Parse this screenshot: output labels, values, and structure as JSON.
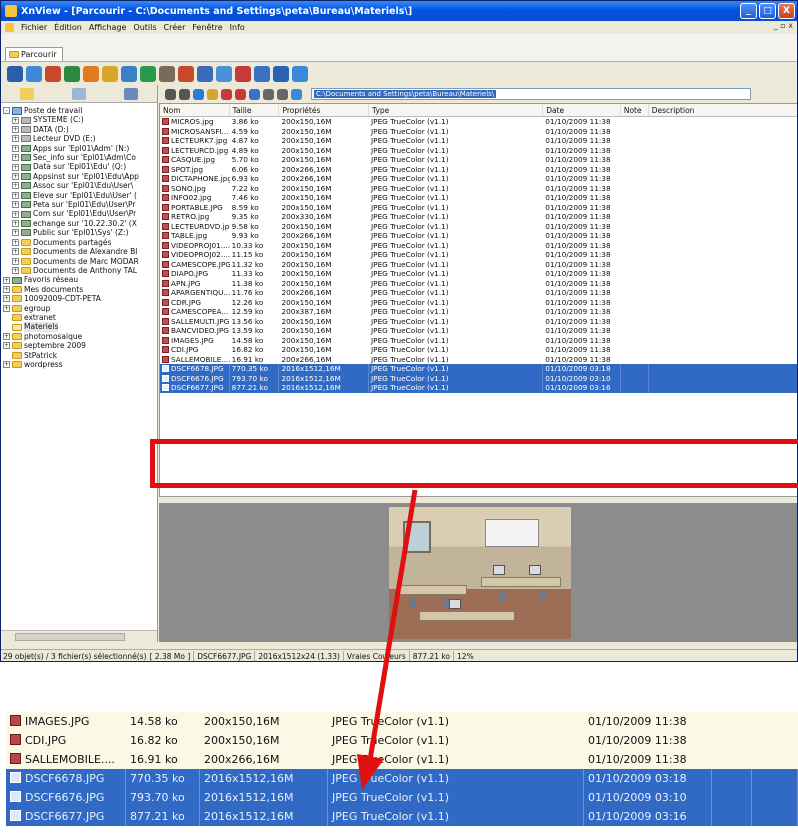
{
  "window": {
    "title": "XnView - [Parcourir - C:\\Documents and Settings\\peta\\Bureau\\Materiels\\]",
    "controls": [
      "_",
      "□",
      "X"
    ]
  },
  "menu": {
    "items": [
      "Fichier",
      "Édition",
      "Affichage",
      "Outils",
      "Créer",
      "Fenêtre",
      "Info"
    ],
    "mdi_controls": "_ ▫ x"
  },
  "tab": {
    "label": "Parcourir"
  },
  "address": {
    "path": "C:\\Documents and Settings\\peta\\Bureau\\Materiels\\"
  },
  "tree": [
    {
      "label": "Poste de travail",
      "icon": "pc",
      "indent": 0,
      "pm": "-"
    },
    {
      "label": "SYSTEME (C:)",
      "icon": "drive",
      "indent": 1,
      "pm": "+"
    },
    {
      "label": "DATA (D:)",
      "icon": "drive",
      "indent": 1,
      "pm": "+"
    },
    {
      "label": "Lecteur DVD (E:)",
      "icon": "drive",
      "indent": 1,
      "pm": "+"
    },
    {
      "label": "Apps sur 'Epl01\\Adm' (N:)",
      "icon": "net",
      "indent": 1,
      "pm": "+"
    },
    {
      "label": "Sec_info sur 'Epl01\\Adm\\Co",
      "icon": "net",
      "indent": 1,
      "pm": "+"
    },
    {
      "label": "Data sur 'Epl01\\Edu' (Q:)",
      "icon": "net",
      "indent": 1,
      "pm": "+"
    },
    {
      "label": "Appsinst sur 'Epl01\\Edu\\App",
      "icon": "net",
      "indent": 1,
      "pm": "+"
    },
    {
      "label": "Assoc sur 'Epl01\\Edu\\User\\",
      "icon": "net",
      "indent": 1,
      "pm": "+"
    },
    {
      "label": "Eleve sur 'Epl01\\Edu\\User' (",
      "icon": "net",
      "indent": 1,
      "pm": "+"
    },
    {
      "label": "Peta sur 'Epl01\\Edu\\User\\Pr",
      "icon": "net",
      "indent": 1,
      "pm": "+"
    },
    {
      "label": "Com sur 'Epl01\\Edu\\User\\Pr",
      "icon": "net",
      "indent": 1,
      "pm": "+"
    },
    {
      "label": "echange sur '10.22.30.2' (X",
      "icon": "net",
      "indent": 1,
      "pm": "+"
    },
    {
      "label": "Public sur 'Epl01\\Sys' (Z:)",
      "icon": "net",
      "indent": 1,
      "pm": "+"
    },
    {
      "label": "Documents partagés",
      "icon": "folder",
      "indent": 1,
      "pm": "+"
    },
    {
      "label": "Documents de Alexandre Bl",
      "icon": "folder",
      "indent": 1,
      "pm": "+"
    },
    {
      "label": "Documents de Marc MODAR",
      "icon": "folder",
      "indent": 1,
      "pm": "+"
    },
    {
      "label": "Documents de Anthony TAL",
      "icon": "folder",
      "indent": 1,
      "pm": "+"
    },
    {
      "label": "Favoris réseau",
      "icon": "net",
      "indent": 0,
      "pm": "+"
    },
    {
      "label": "Mes documents",
      "icon": "folder",
      "indent": 0,
      "pm": "+"
    },
    {
      "label": "10092009-CDT-PETA",
      "icon": "folder",
      "indent": 0,
      "pm": "+"
    },
    {
      "label": "egroup",
      "icon": "folder",
      "indent": 0,
      "pm": "+"
    },
    {
      "label": "extranet",
      "icon": "folder",
      "indent": 0,
      "pm": ""
    },
    {
      "label": "Materiels",
      "icon": "folder-open",
      "indent": 0,
      "pm": ""
    },
    {
      "label": "photomosaique",
      "icon": "folder",
      "indent": 0,
      "pm": "+"
    },
    {
      "label": "septembre 2009",
      "icon": "folder",
      "indent": 0,
      "pm": "+"
    },
    {
      "label": "StPatrick",
      "icon": "folder",
      "indent": 0,
      "pm": ""
    },
    {
      "label": "wordpress",
      "icon": "folder",
      "indent": 0,
      "pm": "+"
    }
  ],
  "list": {
    "columns": [
      "Nom",
      "Taille",
      "Propriétés",
      "Type",
      "Date",
      "Note",
      "Description"
    ],
    "rows": [
      {
        "name": "MICROS.jpg",
        "size": "3.86 ko",
        "props": "200x150,16M",
        "type": "JPEG TrueColor (v1.1)",
        "date": "01/10/2009 11:38",
        "selected": false
      },
      {
        "name": "MICROSANSFI...",
        "size": "4.59 ko",
        "props": "200x150,16M",
        "type": "JPEG TrueColor (v1.1)",
        "date": "01/10/2009 11:38",
        "selected": false
      },
      {
        "name": "LECTEURK7.jpg",
        "size": "4.87 ko",
        "props": "200x150,16M",
        "type": "JPEG TrueColor (v1.1)",
        "date": "01/10/2009 11:38",
        "selected": false
      },
      {
        "name": "LECTEURCD.jpg",
        "size": "4.89 ko",
        "props": "200x150,16M",
        "type": "JPEG TrueColor (v1.1)",
        "date": "01/10/2009 11:38",
        "selected": false
      },
      {
        "name": "CASQUE.jpg",
        "size": "5.70 ko",
        "props": "200x150,16M",
        "type": "JPEG TrueColor (v1.1)",
        "date": "01/10/2009 11:38",
        "selected": false
      },
      {
        "name": "SPOT.jpg",
        "size": "6.06 ko",
        "props": "200x266,16M",
        "type": "JPEG TrueColor (v1.1)",
        "date": "01/10/2009 11:38",
        "selected": false
      },
      {
        "name": "DICTAPHONE.jpg",
        "size": "6.93 ko",
        "props": "200x266,16M",
        "type": "JPEG TrueColor (v1.1)",
        "date": "01/10/2009 11:38",
        "selected": false
      },
      {
        "name": "SONO.jpg",
        "size": "7.22 ko",
        "props": "200x150,16M",
        "type": "JPEG TrueColor (v1.1)",
        "date": "01/10/2009 11:38",
        "selected": false
      },
      {
        "name": "INFO02.jpg",
        "size": "7.46 ko",
        "props": "200x150,16M",
        "type": "JPEG TrueColor (v1.1)",
        "date": "01/10/2009 11:38",
        "selected": false
      },
      {
        "name": "PORTABLE.JPG",
        "size": "8.59 ko",
        "props": "200x150,16M",
        "type": "JPEG TrueColor (v1.1)",
        "date": "01/10/2009 11:38",
        "selected": false
      },
      {
        "name": "RETRO.jpg",
        "size": "9.35 ko",
        "props": "200x330,16M",
        "type": "JPEG TrueColor (v1.1)",
        "date": "01/10/2009 11:38",
        "selected": false
      },
      {
        "name": "LECTEURDVD.jpg",
        "size": "9.58 ko",
        "props": "200x150,16M",
        "type": "JPEG TrueColor (v1.1)",
        "date": "01/10/2009 11:38",
        "selected": false
      },
      {
        "name": "TABLE.jpg",
        "size": "9.93 ko",
        "props": "200x266,16M",
        "type": "JPEG TrueColor (v1.1)",
        "date": "01/10/2009 11:38",
        "selected": false
      },
      {
        "name": "VIDEOPROJ01....",
        "size": "10.33 ko",
        "props": "200x150,16M",
        "type": "JPEG TrueColor (v1.1)",
        "date": "01/10/2009 11:38",
        "selected": false
      },
      {
        "name": "VIDEOPROJ02....",
        "size": "11.15 ko",
        "props": "200x150,16M",
        "type": "JPEG TrueColor (v1.1)",
        "date": "01/10/2009 11:38",
        "selected": false
      },
      {
        "name": "CAMESCOPE.JPG",
        "size": "11.32 ko",
        "props": "200x150,16M",
        "type": "JPEG TrueColor (v1.1)",
        "date": "01/10/2009 11:38",
        "selected": false
      },
      {
        "name": "DIAPO.JPG",
        "size": "11.33 ko",
        "props": "200x150,16M",
        "type": "JPEG TrueColor (v1.1)",
        "date": "01/10/2009 11:38",
        "selected": false
      },
      {
        "name": "APN.JPG",
        "size": "11.38 ko",
        "props": "200x150,16M",
        "type": "JPEG TrueColor (v1.1)",
        "date": "01/10/2009 11:38",
        "selected": false
      },
      {
        "name": "APARGENTIQU...",
        "size": "11.76 ko",
        "props": "200x266,16M",
        "type": "JPEG TrueColor (v1.1)",
        "date": "01/10/2009 11:38",
        "selected": false
      },
      {
        "name": "CDR.JPG",
        "size": "12.26 ko",
        "props": "200x150,16M",
        "type": "JPEG TrueColor (v1.1)",
        "date": "01/10/2009 11:38",
        "selected": false
      },
      {
        "name": "CAMESCOPEA...",
        "size": "12.59 ko",
        "props": "200x387,16M",
        "type": "JPEG TrueColor (v1.1)",
        "date": "01/10/2009 11:38",
        "selected": false
      },
      {
        "name": "SALLEMULTI.JPG",
        "size": "13.56 ko",
        "props": "200x150,16M",
        "type": "JPEG TrueColor (v1.1)",
        "date": "01/10/2009 11:38",
        "selected": false
      },
      {
        "name": "BANCVIDEO.JPG",
        "size": "13.59 ko",
        "props": "200x150,16M",
        "type": "JPEG TrueColor (v1.1)",
        "date": "01/10/2009 11:38",
        "selected": false
      },
      {
        "name": "IMAGES.JPG",
        "size": "14.58 ko",
        "props": "200x150,16M",
        "type": "JPEG TrueColor (v1.1)",
        "date": "01/10/2009 11:38",
        "selected": false
      },
      {
        "name": "CDI.JPG",
        "size": "16.82 ko",
        "props": "200x150,16M",
        "type": "JPEG TrueColor (v1.1)",
        "date": "01/10/2009 11:38",
        "selected": false
      },
      {
        "name": "SALLEMOBILE....",
        "size": "16.91 ko",
        "props": "200x266,16M",
        "type": "JPEG TrueColor (v1.1)",
        "date": "01/10/2009 11:38",
        "selected": false
      },
      {
        "name": "DSCF6678.JPG",
        "size": "770.35 ko",
        "props": "2016x1512,16M",
        "type": "JPEG TrueColor (v1.1)",
        "date": "01/10/2009 03:18",
        "selected": true
      },
      {
        "name": "DSCF6676.JPG",
        "size": "793.70 ko",
        "props": "2016x1512,16M",
        "type": "JPEG TrueColor (v1.1)",
        "date": "01/10/2009 03:10",
        "selected": true
      },
      {
        "name": "DSCF6677.JPG",
        "size": "877.21 ko",
        "props": "2016x1512,16M",
        "type": "JPEG TrueColor (v1.1)",
        "date": "01/10/2009 03:16",
        "selected": true
      }
    ]
  },
  "status": {
    "count": "29 objet(s) / 3 fichier(s) sélectionné(s)",
    "size": "[ 2.38 Mo ]",
    "file": "DSCF6677.JPG",
    "dims": "2016x1512x24 (1.33)",
    "colors": "Vraies Couleurs",
    "filesize": "877.21 ko",
    "zoom": "12%"
  },
  "zoom_rows": [
    {
      "name": "IMAGES.JPG",
      "size": "14.58 ko",
      "props": "200x150,16M",
      "type": "JPEG TrueColor (v1.1)",
      "date": "01/10/2009 11:38",
      "selected": false
    },
    {
      "name": "CDI.JPG",
      "size": "16.82 ko",
      "props": "200x150,16M",
      "type": "JPEG TrueColor (v1.1)",
      "date": "01/10/2009 11:38",
      "selected": false
    },
    {
      "name": "SALLEMOBILE....",
      "size": "16.91 ko",
      "props": "200x266,16M",
      "type": "JPEG TrueColor (v1.1)",
      "date": "01/10/2009 11:38",
      "selected": false
    },
    {
      "name": "DSCF6678.JPG",
      "size": "770.35 ko",
      "props": "2016x1512,16M",
      "type": "JPEG TrueColor (v1.1)",
      "date": "01/10/2009 03:18",
      "selected": true
    },
    {
      "name": "DSCF6676.JPG",
      "size": "793.70 ko",
      "props": "2016x1512,16M",
      "type": "JPEG TrueColor (v1.1)",
      "date": "01/10/2009 03:10",
      "selected": true
    },
    {
      "name": "DSCF6677.JPG",
      "size": "877.21 ko",
      "props": "2016x1512,16M",
      "type": "JPEG TrueColor (v1.1)",
      "date": "01/10/2009 03:16",
      "selected": true
    }
  ],
  "colors": {
    "selection": "#316ac5",
    "highlight": "#e01010",
    "titlebar": "#0054e3"
  }
}
